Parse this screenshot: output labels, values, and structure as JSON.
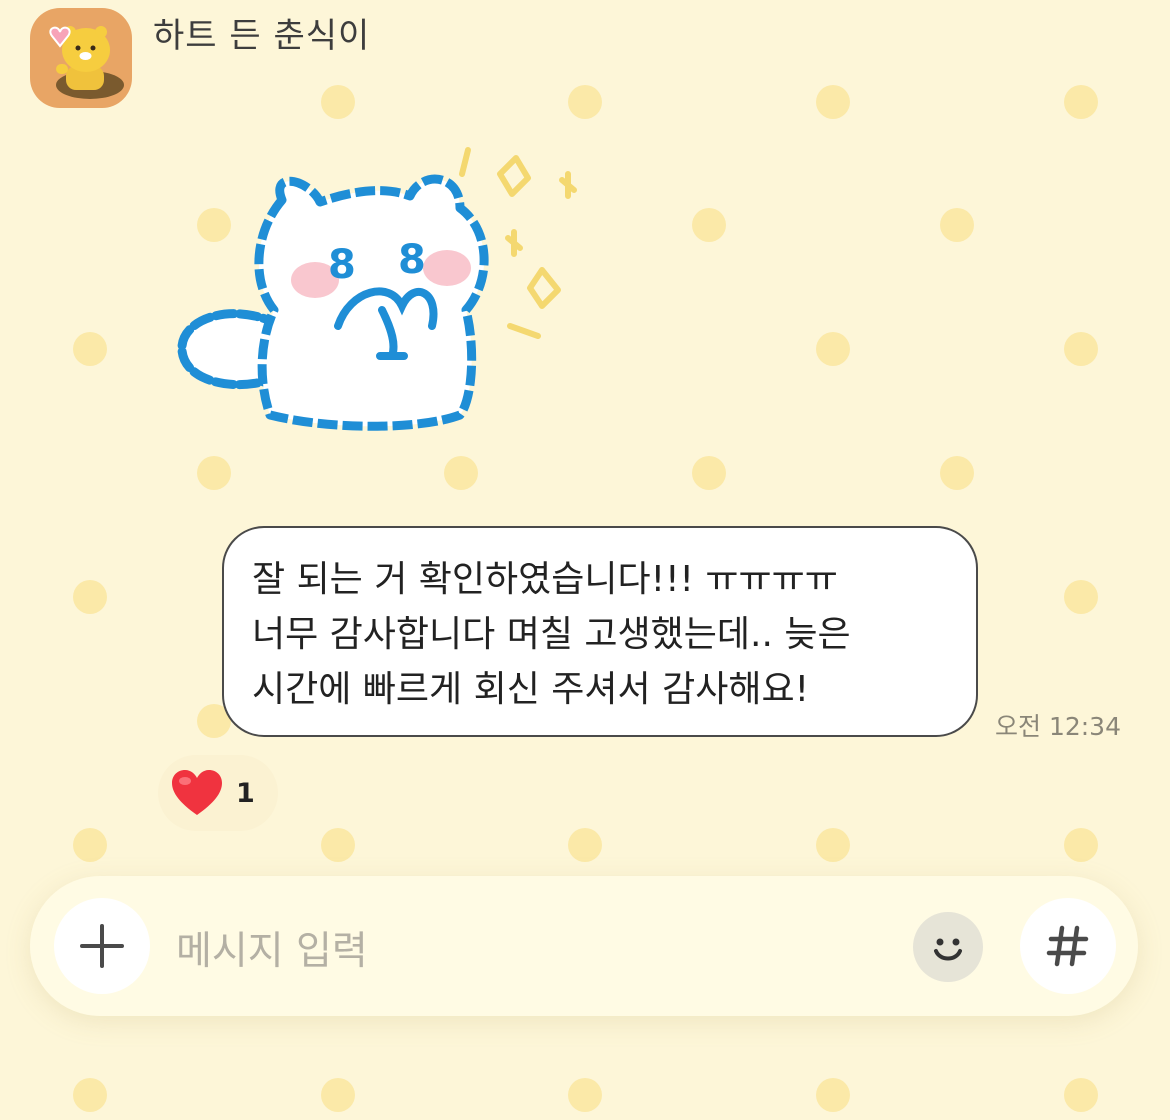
{
  "chat": {
    "sender_name": "하트 든 춘식이",
    "avatar_icon": "choonsik-heart-avatar-icon",
    "sticker_icon": "white-cat-sparkles-sticker-icon",
    "message": {
      "lines": [
        "잘 되는 거 확인하였습니다!!! ㅠㅠㅠㅠ",
        "너무 감사합니다 며칠 고생했는데.. 늦은",
        "시간에 빠르게 회신 주셔서 감사해요!"
      ],
      "time": "오전 12:34"
    },
    "reaction": {
      "icon": "red-heart-icon",
      "count": "1"
    }
  },
  "composer": {
    "placeholder": "메시지 입력",
    "add_icon": "plus-icon",
    "emoticon_icon": "smile-emoticon-icon",
    "hashtag_icon": "hash-icon"
  },
  "colors": {
    "background": "#fdf6d8",
    "dot": "#fbe9a8",
    "bubble": "#ffffff",
    "bubble_border": "#4a4a4a",
    "sticker_outline": "#1f8ed6",
    "heart": "#f0333f"
  }
}
